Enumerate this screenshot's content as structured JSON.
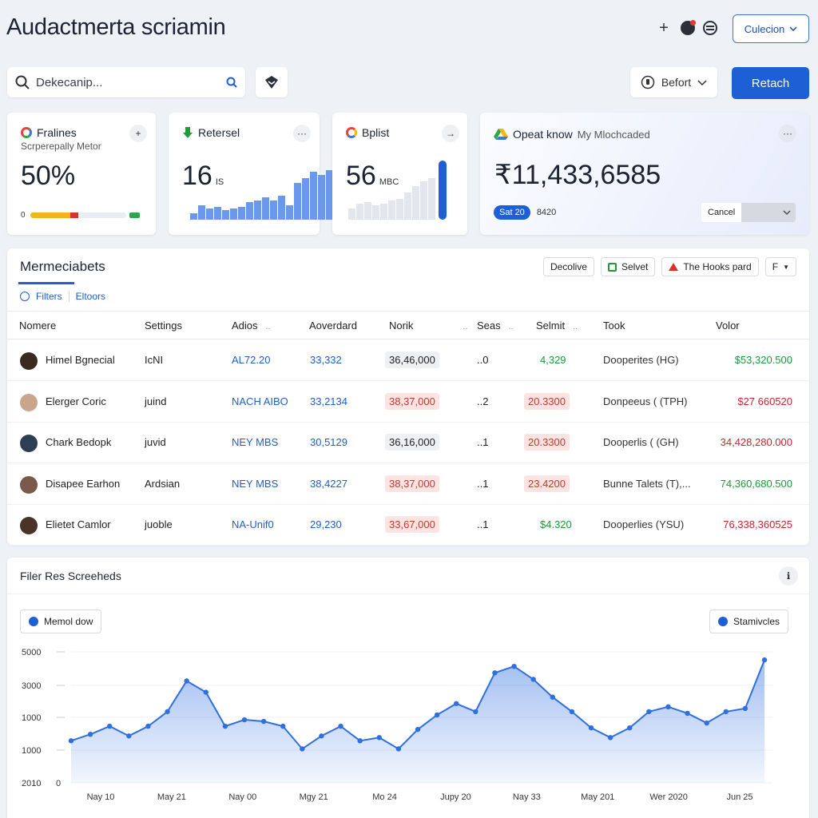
{
  "header": {
    "title": "Audactmerta scriamin",
    "collection_label": "Culecion"
  },
  "toolbar": {
    "search_placeholder": "Dekecanip...",
    "before_label": "Befort",
    "primary_label": "Retach"
  },
  "cards": [
    {
      "title": "Fralines",
      "subtitle": "Scrperepally Metor",
      "value": "50%",
      "progress_min": "0",
      "progress_fraction": 0.5
    },
    {
      "title": "Retersel",
      "value": "16",
      "unit": "IS"
    },
    {
      "title": "Bplist",
      "value": "56",
      "unit": "MBC"
    },
    {
      "title": "Opeat know",
      "subtitle": "My Mlochcaded",
      "value": "₹11,433,6585",
      "badge": "Sat 20",
      "badge_value": "8420",
      "cancel_label": "Cancel"
    }
  ],
  "table": {
    "title": "Mermeciabets",
    "tools": [
      "Decolive",
      "Selvet",
      "The Hooks pard",
      "F"
    ],
    "filters": [
      "Filters",
      "Eltoors"
    ],
    "columns": [
      "Nomere",
      "Settings",
      "Adios",
      "Aoverdard",
      "Norik",
      "Seas",
      "Selmit",
      "Took",
      "Volor"
    ],
    "rows": [
      {
        "name": "Himel Bgnecial",
        "setting": "IcNI",
        "adios": "AL72.20",
        "aover": "33,332",
        "norik": "36,46,000",
        "norik_tone": "gray",
        "seas": "..0",
        "selmit": "4,329",
        "selmit_tone": "green",
        "took": "Dooperites (HG)",
        "volor": "$53,320.500",
        "volor_tone": "green"
      },
      {
        "name": "Elerger Coric",
        "setting": "juind",
        "adios": "NACH AIBO",
        "aover": "33,2134",
        "norik": "38,37,000",
        "norik_tone": "red",
        "seas": "..2",
        "selmit": "20.3300",
        "selmit_tone": "redpill",
        "took": "Donpeeus ( (TPH)",
        "volor": "$27 660520",
        "volor_tone": "red"
      },
      {
        "name": "Chark Bedopk",
        "setting": "juvid",
        "adios": "NEY MBS",
        "aover": "30,5129",
        "norik": "36,16,000",
        "norik_tone": "gray",
        "seas": "..1",
        "selmit": "20.3300",
        "selmit_tone": "redpill",
        "took": "Dooperlis ( (GH)",
        "volor": "34,428,280.000",
        "volor_tone": "red"
      },
      {
        "name": "Disapee Earhon",
        "setting": "Ardsian",
        "adios": "NEY MBS",
        "aover": "38,4227",
        "norik": "38,37,000",
        "norik_tone": "red",
        "seas": "..1",
        "selmit": "23.4200",
        "selmit_tone": "redpill",
        "took": "Bunne Talets (T),...",
        "volor": "74,360,680.500",
        "volor_tone": "green"
      },
      {
        "name": "Elietet Camlor",
        "setting": "juoble",
        "adios": "NA-Unif0",
        "aover": "29,230",
        "norik": "33,67,000",
        "norik_tone": "red",
        "seas": "..1",
        "selmit": "$4.320",
        "selmit_tone": "green",
        "took": "Dooperlies (YSU)",
        "volor": "76,338,360525",
        "volor_tone": "red"
      }
    ]
  },
  "chart_section": {
    "title": "Filer Res Screeheds",
    "chip_left": "Memol dow",
    "chip_right": "Stamivcles"
  },
  "chart_data": {
    "type": "area",
    "y_tick_labels": [
      "5000",
      "3000",
      "1000",
      "1000",
      "2010"
    ],
    "zero_label": "0",
    "x_tick_labels": [
      "Nay 10",
      "May 21",
      "Nay 00",
      "Mgy 21",
      "Mo 24",
      "Jupy 20",
      "Nay 33",
      "May 201",
      "Wer 2020",
      "Jun 25"
    ],
    "ylim": [
      0,
      4000
    ],
    "grid": true,
    "color": "#2f6fe0",
    "values": [
      1300,
      1500,
      1750,
      1450,
      1750,
      2200,
      3150,
      2800,
      1750,
      1950,
      1900,
      1750,
      1050,
      1450,
      1750,
      1300,
      1400,
      1050,
      1650,
      2100,
      2450,
      2200,
      3400,
      3600,
      3200,
      2650,
      2200,
      1700,
      1400,
      1700,
      2200,
      2350,
      2150,
      1850,
      2200,
      2300,
      3800
    ]
  }
}
